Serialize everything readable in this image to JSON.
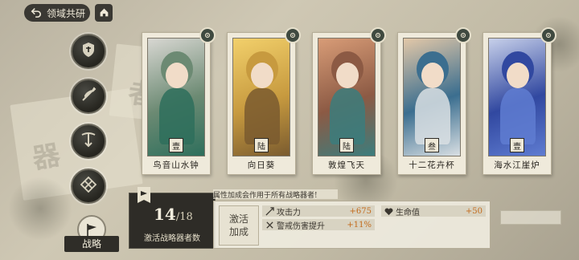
{
  "topbar": {
    "title": "领域共研",
    "back_icon": "back-arrow-icon",
    "home_icon": "home-icon"
  },
  "side_buttons": [
    {
      "icon": "shield-icon"
    },
    {
      "icon": "sword-feather-icon"
    },
    {
      "icon": "crossbow-icon"
    },
    {
      "icon": "knot-icon"
    }
  ],
  "strategy": {
    "label": "战略",
    "icon": "flag-icon"
  },
  "cards": [
    {
      "name": "鸟音山水钟",
      "mark": "壹",
      "palette": [
        "#6c8a73",
        "#d8d7d2",
        "#2e6f5c"
      ]
    },
    {
      "name": "向日葵",
      "mark": "陆",
      "palette": [
        "#c79a3f",
        "#f2d06b",
        "#7a5b2f"
      ]
    },
    {
      "name": "敦煌飞天",
      "mark": "陆",
      "palette": [
        "#8c5a44",
        "#d89c77",
        "#3b7d7d"
      ]
    },
    {
      "name": "十二花卉杯",
      "mark": "叁",
      "palette": [
        "#3b6e8f",
        "#e3c8a8",
        "#d9dfe3"
      ]
    },
    {
      "name": "海水江崖炉",
      "mark": "壹",
      "palette": [
        "#3148a0",
        "#c7d0ea",
        "#5f7cd1"
      ]
    }
  ],
  "count_panel": {
    "current": "14",
    "total": "/18",
    "label": "激活战略器者数"
  },
  "bonus": {
    "note": "属性加成会作用于所有战略器者!",
    "activate_line1": "激活",
    "activate_line2": "加成",
    "stats": [
      {
        "label": "攻击力",
        "value": "+675",
        "icon": "attack-icon"
      },
      {
        "label": "生命值",
        "value": "+50",
        "icon": "heart-icon"
      },
      {
        "label": "警戒伤害提升",
        "value": "+11%",
        "icon": "alert-damage-icon"
      }
    ]
  },
  "colors": {
    "panel_dark": "#2e2c27",
    "accent_value": "#c36a1a",
    "card_bg": "#efeadb"
  }
}
